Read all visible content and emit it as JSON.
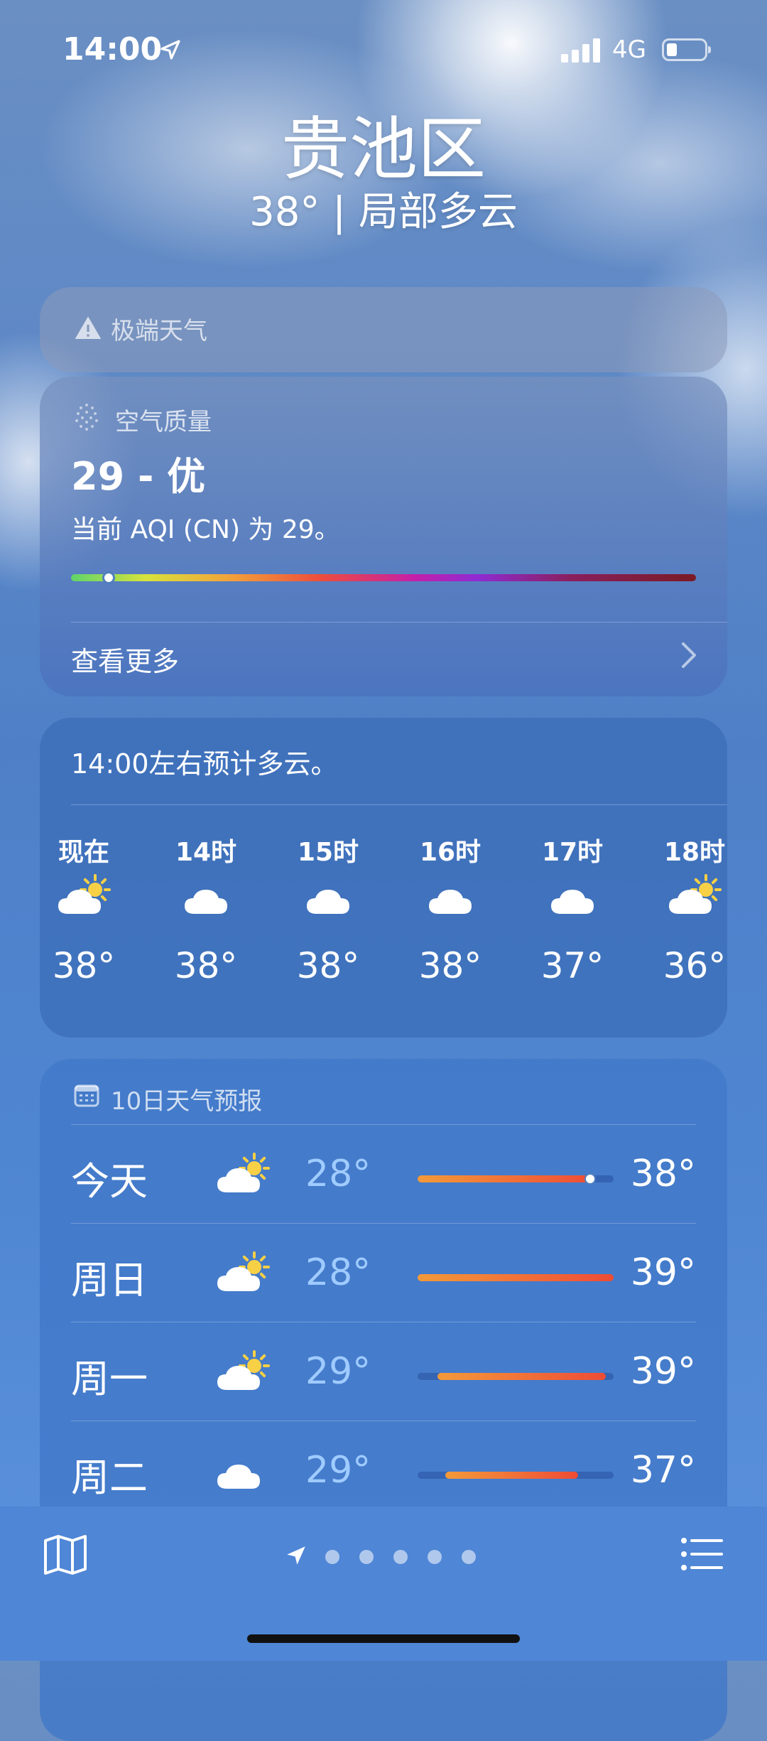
{
  "status_bar": {
    "time": "14:00",
    "network": "4G",
    "battery_level": 0.2
  },
  "header": {
    "city": "贵池区",
    "condition": "38° | 局部多云"
  },
  "alert": {
    "icon": "warning-icon",
    "label": "极端天气"
  },
  "air_quality": {
    "label": "空气质量",
    "value": "29 - 优",
    "description": "当前 AQI (CN) 为 29。",
    "scale_position": 0.06,
    "more": "查看更多"
  },
  "hourly": {
    "summary": "14:00左右预计多云。",
    "items": [
      {
        "hour": "现在",
        "icon": "partly-sunny-icon",
        "temp": "38°"
      },
      {
        "hour": "14时",
        "icon": "cloud-icon",
        "temp": "38°"
      },
      {
        "hour": "15时",
        "icon": "cloud-icon",
        "temp": "38°"
      },
      {
        "hour": "16时",
        "icon": "cloud-icon",
        "temp": "38°"
      },
      {
        "hour": "17时",
        "icon": "cloud-icon",
        "temp": "37°"
      },
      {
        "hour": "18时",
        "icon": "partly-sunny-icon",
        "temp": "36°"
      }
    ]
  },
  "daily": {
    "label": "10日天气预报",
    "icon": "calendar-icon",
    "days": [
      {
        "day": "今天",
        "icon": "partly-sunny-icon",
        "low": "28°",
        "high": "38°",
        "bar_start": 0.0,
        "bar_end": 0.9,
        "current": 0.88
      },
      {
        "day": "周日",
        "icon": "partly-sunny-icon",
        "low": "28°",
        "high": "39°",
        "bar_start": 0.0,
        "bar_end": 1.0
      },
      {
        "day": "周一",
        "icon": "partly-sunny-icon",
        "low": "29°",
        "high": "39°",
        "bar_start": 0.1,
        "bar_end": 0.96
      },
      {
        "day": "周二",
        "icon": "cloud-icon",
        "low": "29°",
        "high": "37°",
        "bar_start": 0.14,
        "bar_end": 0.82
      }
    ]
  },
  "tabbar": {
    "map_icon": "map-icon",
    "location_icon": "location-arrow-icon",
    "page_count": 5,
    "list_icon": "list-icon"
  }
}
